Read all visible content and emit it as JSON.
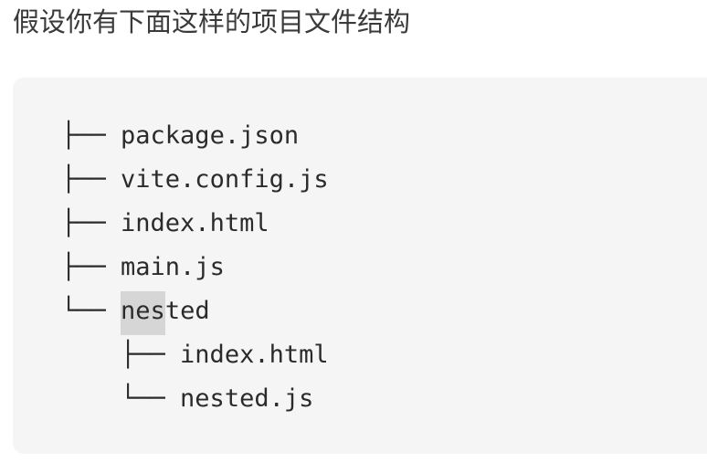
{
  "intro_text": "假设你有下面这样的项目文件结构",
  "tree": {
    "lines": [
      {
        "branch": "├── ",
        "name": "package.json"
      },
      {
        "branch": "├── ",
        "name": "vite.config.js"
      },
      {
        "branch": "├── ",
        "name": "index.html"
      },
      {
        "branch": "├── ",
        "name": "main.js"
      },
      {
        "branch": "└── ",
        "name_before": "",
        "name_highlight": "nes",
        "name_after": "ted"
      },
      {
        "branch": "    ├── ",
        "name": "index.html"
      },
      {
        "branch": "    └── ",
        "name": "nested.js"
      }
    ]
  }
}
